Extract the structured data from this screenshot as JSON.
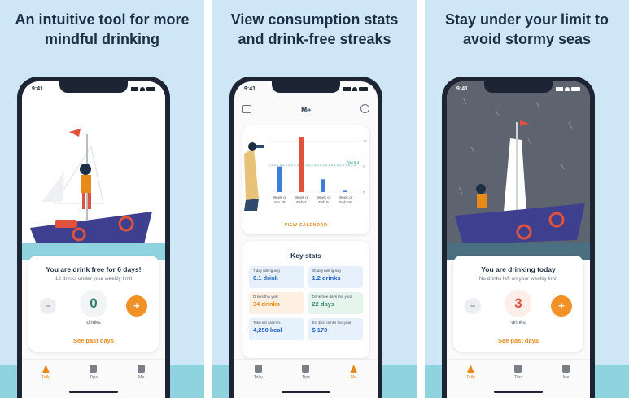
{
  "panels": [
    {
      "headline": "An intuitive tool for more mindful drinking",
      "time": "9:41",
      "card": {
        "title": "You are drink free for 6 days!",
        "subtitle": "12 drinks under your weekly limit",
        "minus": "−",
        "count": "0",
        "count_label": "drinks",
        "plus": "+",
        "link": "See past days"
      },
      "tabs": [
        {
          "label": "Tally"
        },
        {
          "label": "Tips"
        },
        {
          "label": "Me"
        }
      ]
    },
    {
      "headline": "View consumption stats and drink-free streaks",
      "time": "9:41",
      "title": "Me",
      "view_calendar": "VIEW CALENDAR",
      "key_stats": {
        "title": "Key stats",
        "items": [
          {
            "label": "7 day rolling avg",
            "value": "0.1 drink"
          },
          {
            "label": "30 day rolling avg",
            "value": "1.2 drinks"
          },
          {
            "label": "Drinks this year",
            "value": "34 drinks"
          },
          {
            "label": "Drink-free days this year",
            "value": "22 days"
          },
          {
            "label": "Total est calories",
            "value": "4,250 kcal"
          },
          {
            "label": "Est $ on drinks this year",
            "value": "$ 170"
          }
        ]
      },
      "tabs": [
        {
          "label": "Tally"
        },
        {
          "label": "Tips"
        },
        {
          "label": "Me"
        }
      ]
    },
    {
      "headline": "Stay under your limit to avoid stormy seas",
      "time": "9:41",
      "card": {
        "title": "You are drinking today",
        "subtitle": "No drinks left on your weekly limit",
        "minus": "−",
        "count": "3",
        "count_label": "drinks",
        "plus": "+",
        "link": "See past days"
      },
      "tabs": [
        {
          "label": "Tally"
        },
        {
          "label": "Tips"
        },
        {
          "label": "Me"
        }
      ]
    }
  ],
  "chart_data": {
    "type": "bar",
    "categories": [
      "Week of Jan 26",
      "Week of Feb 2",
      "Week of Feb 9",
      "Week of Feb 16"
    ],
    "values": [
      6,
      13,
      3,
      0.3
    ],
    "highlight_color": "#e1523d",
    "series_color": "#3c7fd6",
    "avg_label": "Avg 6.3",
    "avg_value": 6.3,
    "y_ticks": [
      "12",
      "6",
      "0"
    ],
    "ylim": [
      0,
      13
    ]
  }
}
